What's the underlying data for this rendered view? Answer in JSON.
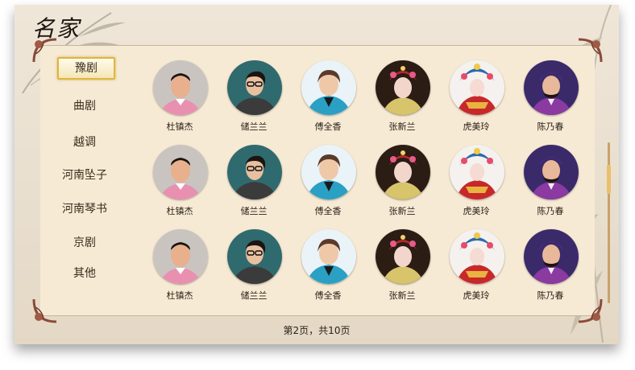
{
  "header": {
    "title": "名家"
  },
  "nav": {
    "items": [
      {
        "label": "豫剧",
        "active": true
      },
      {
        "label": "曲剧",
        "active": false
      },
      {
        "label": "越调",
        "active": false
      },
      {
        "label": "河南坠子",
        "active": false
      },
      {
        "label": "河南琴书",
        "active": false
      },
      {
        "label": "京剧",
        "active": false
      },
      {
        "label": "其他",
        "active": false
      }
    ]
  },
  "artists": [
    [
      {
        "name": "杜镇杰",
        "style": "man-pink"
      },
      {
        "name": "储兰兰",
        "style": "woman-glasses"
      },
      {
        "name": "傅全香",
        "style": "elder-woman"
      },
      {
        "name": "张新兰",
        "style": "opera-female"
      },
      {
        "name": "虎美玲",
        "style": "opera-ornate"
      },
      {
        "name": "陈乃春",
        "style": "opera-male"
      }
    ],
    [
      {
        "name": "杜镇杰",
        "style": "man-pink"
      },
      {
        "name": "储兰兰",
        "style": "woman-glasses"
      },
      {
        "name": "傅全香",
        "style": "elder-woman"
      },
      {
        "name": "张新兰",
        "style": "opera-female"
      },
      {
        "name": "虎美玲",
        "style": "opera-ornate"
      },
      {
        "name": "陈乃春",
        "style": "opera-male"
      }
    ],
    [
      {
        "name": "杜镇杰",
        "style": "man-pink"
      },
      {
        "name": "储兰兰",
        "style": "woman-glasses"
      },
      {
        "name": "傅全香",
        "style": "elder-woman"
      },
      {
        "name": "张新兰",
        "style": "opera-female"
      },
      {
        "name": "虎美玲",
        "style": "opera-ornate"
      },
      {
        "name": "陈乃春",
        "style": "opera-male"
      }
    ]
  ],
  "pager": {
    "text": "第2页，共10页"
  },
  "colors": {
    "accent": "#e0b53c",
    "text": "#2a2118"
  }
}
